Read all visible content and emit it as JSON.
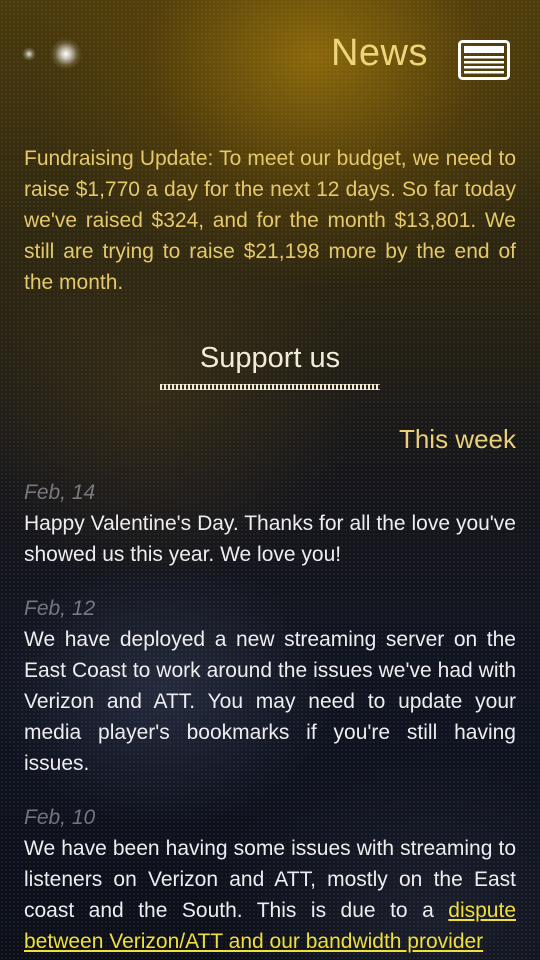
{
  "header": {
    "title": "News",
    "icon": "newspaper-icon",
    "pager_icon": "page-indicator-dots"
  },
  "notice": {
    "text": "Fundraising Update: To meet our budget, we need to raise $1,770 a day for the next 12 days. So far today we've raised $324, and for the month $13,801. We still are trying to raise $21,198 more by the end of the month."
  },
  "support": {
    "label": "Support us"
  },
  "feed": {
    "heading": "This week",
    "entries": [
      {
        "date": "Feb, 14",
        "text": "Happy Valentine's Day. Thanks for all the love you've showed us this year. We love you!"
      },
      {
        "date": "Feb, 12",
        "text": "We have deployed a new streaming server on the East Coast to work around the issues we've had with Verizon and ATT. You may need to update your media player's bookmarks if you're still having issues."
      },
      {
        "date": "Feb, 10",
        "text": "We have been having some issues with streaming to listeners on Verizon and ATT, mostly on the East coast and the South. This is due to a ",
        "link": "dispute between Verizon/ATT and our bandwidth provider"
      }
    ]
  },
  "colors": {
    "title": "#efd57a",
    "notice": "#e4c86a",
    "body_text": "#ededf0",
    "link": "#f0de3a",
    "date": "#9a9aa6"
  }
}
